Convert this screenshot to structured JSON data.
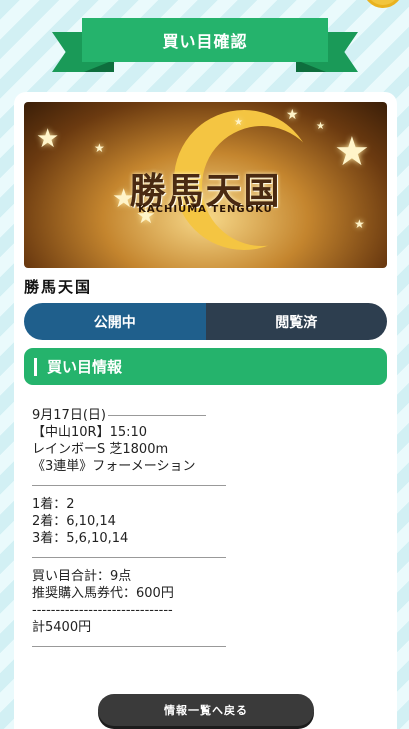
{
  "header": {
    "title": "買い目確認"
  },
  "banner": {
    "logo_text": "勝馬天国",
    "logo_sub": "KACHIUMA TENGOKU"
  },
  "app": {
    "name": "勝馬天国"
  },
  "tabs": [
    {
      "label": "公開中",
      "active": true
    },
    {
      "label": "閲覧済",
      "active": false
    }
  ],
  "section": {
    "title": "買い目情報"
  },
  "info": {
    "date": "9月17日(日)",
    "race": "【中山10R】15:10",
    "race_name": "レインボーS 芝1800m",
    "bet_type": "《3連単》フォーメーション",
    "first": "1着：2",
    "second": "2着：6,10,14",
    "third": "3着：5,6,10,14",
    "total_points": "買い目合計：9点",
    "recommended": "推奨購入馬券代：600円",
    "divider": "------------------------------",
    "total": "計5400円"
  },
  "back_button": {
    "label": "情報一覧へ戻る"
  },
  "colors": {
    "green": "#25b36c",
    "tab_active": "#1f5f8c",
    "tab_inactive": "#2d3e4f"
  }
}
